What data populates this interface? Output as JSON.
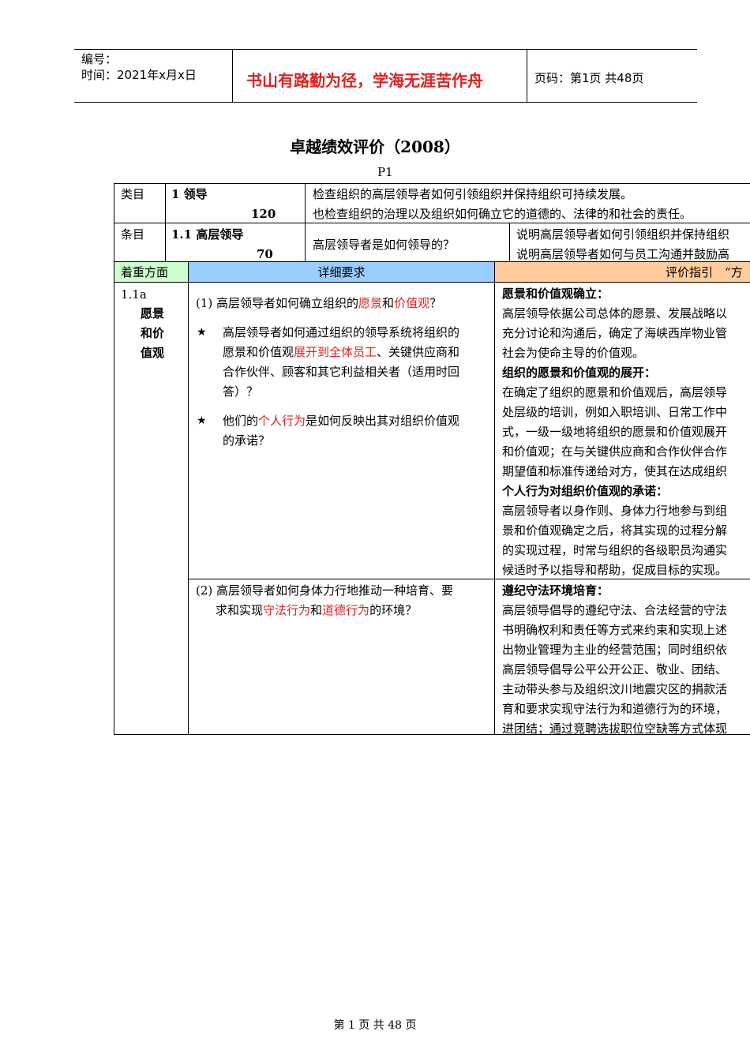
{
  "header": {
    "number_label": "编号：",
    "time_label": "时间：2021年x月x日",
    "motto": "书山有路勤为径，学海无涯苦作舟",
    "page_label": "页码：第1页  共48页"
  },
  "title": "卓越绩效评价（2008）",
  "page_marker": "P1",
  "row_category": {
    "label": "类目",
    "name": "1 领导",
    "score": "120",
    "desc_line1": "检查组织的高层领导者如何引领组织并保持组织可持续发展。",
    "desc_line2": "也检查组织的治理以及组织如何确立它的道德的、法律的和社会的责任。"
  },
  "row_item": {
    "label": "条目",
    "name": "1.1 高层领导",
    "score": "70",
    "question": "高层领导者是如何领导的？",
    "note_line1": "说明高层领导者如何引领组织并保持组织",
    "note_line2": "说明高层领导者如何与员工沟通并鼓励高"
  },
  "columns": {
    "focus": "着重方面",
    "detail": "详细要求",
    "guide": "评价指引　“方"
  },
  "section_a": {
    "code": "1.1a",
    "name_1": "愿景",
    "name_2": "和价",
    "name_3": "值观",
    "q1_pre": "(1)  高层领导者如何确立组织的",
    "q1_red1": "愿景",
    "q1_mid": "和",
    "q1_red2": "价值观",
    "q1_post": "？",
    "star": "★",
    "b1_l1": "高层领导者如何通过组织的领导系统将组织的",
    "b1_l2_pre": "愿景和价值观",
    "b1_l2_red": "展开到全体员工",
    "b1_l2_post": "、关键供应商和",
    "b1_l3": "合作伙伴、顾客和其它利益相关者（适用时回",
    "b1_l4": "答）？",
    "b2_l1_pre": "他们的",
    "b2_l1_red": "个人行为",
    "b2_l1_post": "是如何反映出其对组织价值观",
    "b2_l2": "的承诺？",
    "g_h1": "愿景和价值观确立：",
    "g_1": "高层领导依据公司总体的愿景、发展战略以",
    "g_2": "充分讨论和沟通后，确定了海峡西岸物业管",
    "g_3": "社会为使命主导的价值观。",
    "g_h2": "组织的愿景和价值观的展开：",
    "g_4": "在确定了组织的愿景和价值观后，高层领导",
    "g_5": "处层级的培训，例如入职培训、日常工作中",
    "g_6": "式，一级一级地将组织的愿景和价值观展开",
    "g_7": "和价值观；在与关键供应商和合作伙伴合作",
    "g_8": "期望值和标准传递给对方，使其在达成组织",
    "g_h3": "个人行为对组织价值观的承诺：",
    "g_9": "高层领导者以身作则、身体力行地参与到组",
    "g_10": "景和价值观确定之后，将其实现的过程分解",
    "g_11": "的实现过程，时常与组织的各级职员沟通实",
    "g_12": "候适时予以指导和帮助，促成目标的实现。"
  },
  "section_b": {
    "q2_l1": "(2)  高层领导者如何身体力行地推动一种培育、要",
    "q2_l2_pre": "求和实现",
    "q2_l2_red1": "守法行为",
    "q2_l2_mid": "和",
    "q2_l2_red2": "道德行为",
    "q2_l2_post": "的环境？",
    "g_h1": "遵纪守法环境培育：",
    "g_1": "高层领导倡导的遵纪守法、合法经营的守法",
    "g_2": "书明确权利和责任等方式来约束和实现上述",
    "g_3": "出物业管理为主业的经营范围；同时组织依",
    "g_4": "高层领导倡导公平公开公正、敬业、团结、",
    "g_5": "主动带头参与及组织汶川地震灾区的捐款活",
    "g_6": "育和要求实现守法行为和道德行为的环境，",
    "g_7": "进团结；通过竞聘选拔职位空缺等方式体现"
  },
  "footer": "第 1 页 共 48 页",
  "colors": {
    "focus_header_bg": "#ccffcc",
    "detail_header_bg": "#99ccff",
    "guide_header_bg": "#ffcc99",
    "highlight": "#e02020"
  }
}
